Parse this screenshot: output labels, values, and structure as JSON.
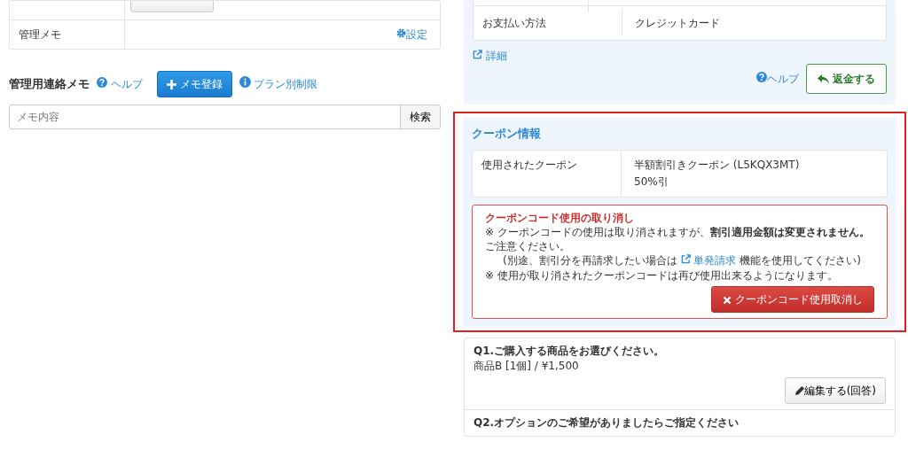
{
  "admin_table": {
    "rows": [
      {
        "label": "管理メモ",
        "link": "設定"
      }
    ]
  },
  "memo_section": {
    "title": "管理用連絡メモ",
    "help": "ヘルプ",
    "add_button": "メモ登録",
    "plan_link": "プラン別制限",
    "search": {
      "placeholder": "メモ内容",
      "button": "検索"
    }
  },
  "payment": {
    "rows": [
      {
        "label": "お支払い方法",
        "value": "クレジットカード"
      }
    ],
    "details_link": "詳細",
    "help": "ヘルプ",
    "refund_button": "返金する"
  },
  "coupon": {
    "title": "クーポン情報",
    "rows": [
      {
        "label": "使用されたクーポン",
        "lines": [
          "半額割引きクーポン (L5KQX3MT)",
          "50%引"
        ]
      }
    ],
    "cancel_box": {
      "title": "クーポンコード使用の取り消し",
      "lines": [
        {
          "text": "※ クーポンコードの使用は取り消されますが、**割引適用金額は変更されません。**"
        },
        {
          "text": "ご注意ください。"
        },
        {
          "before": "(別途、割引分を再請求したい場合は",
          "link": "単発請求",
          "after": "機能を使用してください)"
        },
        {
          "text": "※ 使用が取り消されたクーポンコードは再び使用出来るようになります。"
        }
      ],
      "button": "クーポンコード使用取消し"
    }
  },
  "answers": [
    {
      "question": "Q1.ご購入する商品をお選びください。",
      "answer": "商品B [1個] / ¥1,500",
      "edit_button": "編集する(回答)"
    },
    {
      "question": "Q2.オプションのご希望がありましたらご指定ください"
    }
  ]
}
